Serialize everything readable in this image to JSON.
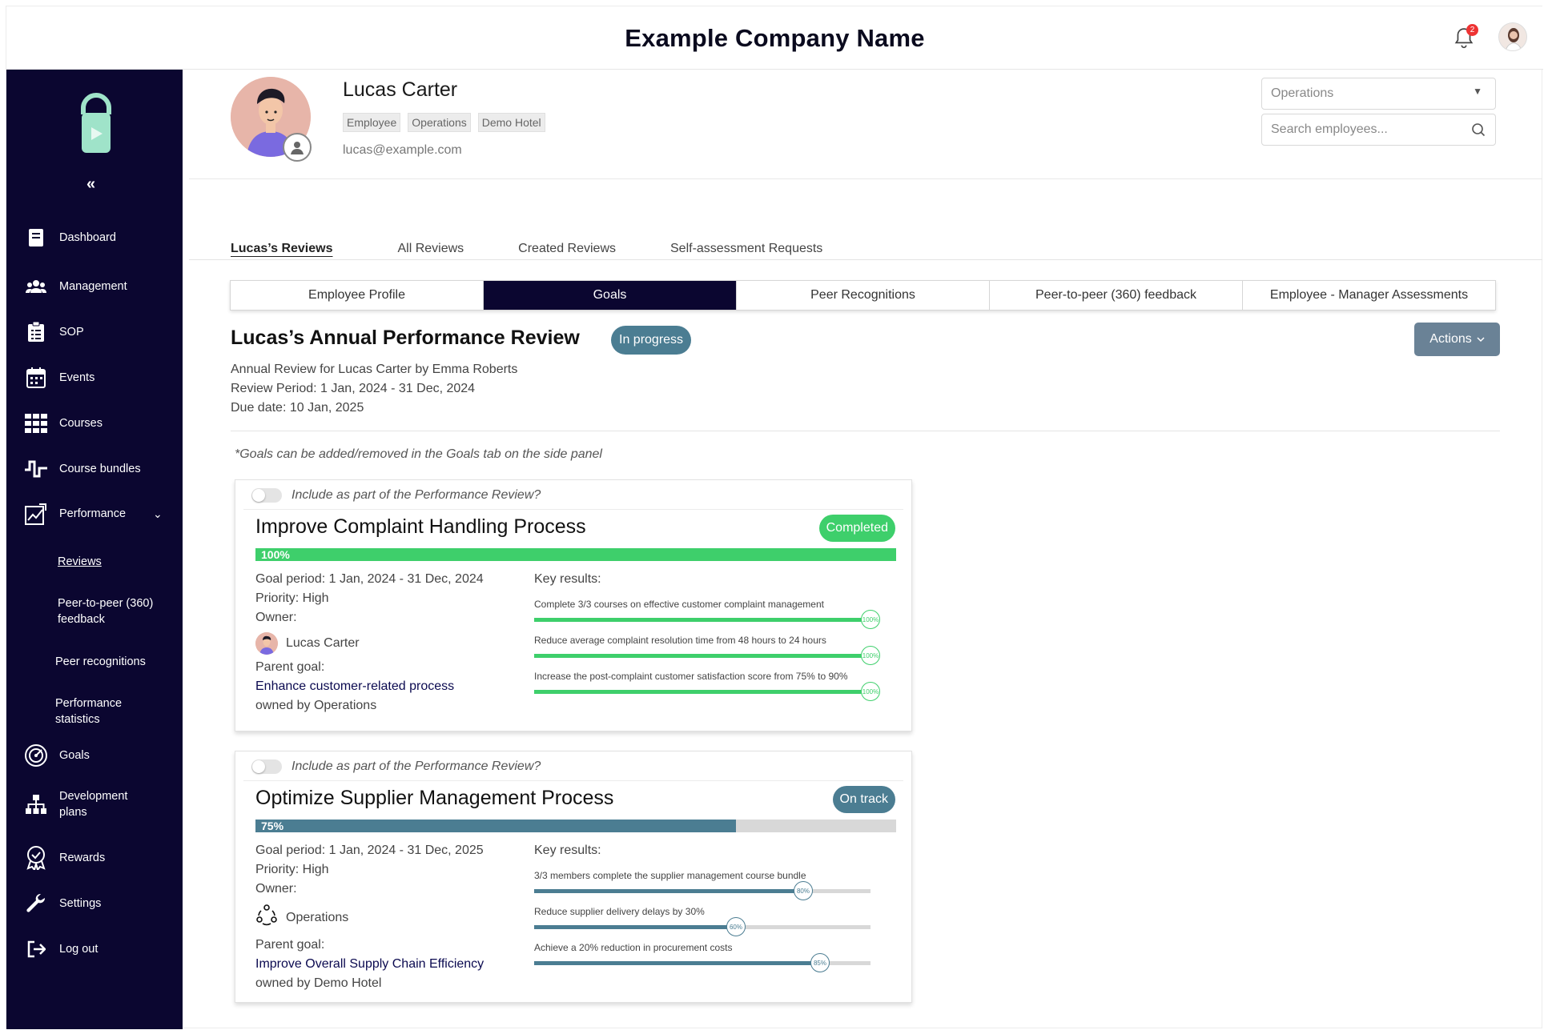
{
  "header": {
    "company_name": "Example Company Name",
    "notifications_count": "2"
  },
  "sidebar": {
    "collapse_label": "«",
    "items": [
      {
        "label": "Dashboard",
        "icon": "book-icon"
      },
      {
        "label": "Management",
        "icon": "users-group-icon"
      },
      {
        "label": "SOP",
        "icon": "clipboard-icon"
      },
      {
        "label": "Events",
        "icon": "calendar-icon"
      },
      {
        "label": "Courses",
        "icon": "grid-icon"
      },
      {
        "label": "Course bundles",
        "icon": "bundle-icon"
      },
      {
        "label": "Performance",
        "icon": "chart-icon"
      },
      {
        "label": "Goals",
        "icon": "target-icon"
      },
      {
        "label": "Development plans",
        "icon": "hierarchy-icon"
      },
      {
        "label": "Rewards",
        "icon": "award-icon"
      },
      {
        "label": "Settings",
        "icon": "wrench-icon"
      },
      {
        "label": "Log out",
        "icon": "logout-icon"
      }
    ],
    "performance_sub": [
      {
        "label": "Reviews"
      },
      {
        "label": "Peer-to-peer (360) feedback"
      },
      {
        "label": "Peer recognitions"
      },
      {
        "label": "Performance statistics"
      }
    ]
  },
  "profile": {
    "name": "Lucas Carter",
    "tags": [
      "Employee",
      "Operations",
      "Demo Hotel"
    ],
    "email": "lucas@example.com"
  },
  "filters": {
    "department": "Operations",
    "search_placeholder": "Search employees..."
  },
  "review_tabs": [
    "Lucas’s Reviews",
    "All Reviews",
    "Created Reviews",
    "Self-assessment Requests"
  ],
  "section_tabs": [
    "Employee Profile",
    "Goals",
    "Peer Recognitions",
    "Peer-to-peer (360) feedback",
    "Employee - Manager Assessments"
  ],
  "review": {
    "title": "Lucas’s Annual Performance Review",
    "status": "In progress",
    "actions_label": "Actions",
    "subtitle": "Annual Review for Lucas Carter by Emma Roberts",
    "period": "Review Period: 1 Jan, 2024 - 31 Dec, 2024",
    "due": "Due date: 10 Jan, 2025",
    "goals_note": "*Goals can be added/removed in the Goals tab on the side panel"
  },
  "goals": [
    {
      "include_label": "Include as part of the Performance Review?",
      "title": "Improve Complaint Handling Process",
      "status": "Completed",
      "status_color": "#3ecf6b",
      "progress": 1.0,
      "progress_label": "100%",
      "period": "Goal period: 1 Jan, 2024 - 31 Dec, 2024",
      "priority": "Priority: High",
      "owner_label": "Owner:",
      "owner": "Lucas Carter",
      "parent_label": "Parent goal:",
      "parent_goal": "Enhance customer-related process",
      "owned_by": "owned by Operations",
      "key_results_label": "Key results:",
      "key_results": [
        {
          "text": "Complete 3/3 courses on effective customer complaint management",
          "progress": 1.0,
          "label": "100%"
        },
        {
          "text": "Reduce average complaint resolution time from 48 hours to 24 hours",
          "progress": 1.0,
          "label": "100%"
        },
        {
          "text": "Increase the post-complaint customer satisfaction score from 75% to 90%",
          "progress": 1.0,
          "label": "100%"
        }
      ]
    },
    {
      "include_label": "Include as part of the Performance Review?",
      "title": "Optimize Supplier Management Process",
      "status": "On track",
      "status_color": "#4b7d92",
      "progress": 0.75,
      "progress_label": "75%",
      "period": "Goal period: 1 Jan, 2024 - 31 Dec, 2025",
      "priority": "Priority: High",
      "owner_label": "Owner:",
      "owner": "Operations",
      "parent_label": "Parent goal:",
      "parent_goal": "Improve Overall Supply Chain Efficiency",
      "owned_by": "owned by Demo Hotel",
      "key_results_label": "Key results:",
      "key_results": [
        {
          "text": "3/3 members complete the supplier management course bundle",
          "progress": 0.8,
          "label": "80%"
        },
        {
          "text": "Reduce supplier delivery delays by 30%",
          "progress": 0.6,
          "label": "60%"
        },
        {
          "text": "Achieve a 20% reduction in procurement costs",
          "progress": 0.85,
          "label": "85%"
        }
      ]
    }
  ],
  "colors": {
    "sidebar_bg": "#0b0630",
    "complete_green": "#3ecf6b",
    "on_track_teal": "#4b7d92"
  }
}
